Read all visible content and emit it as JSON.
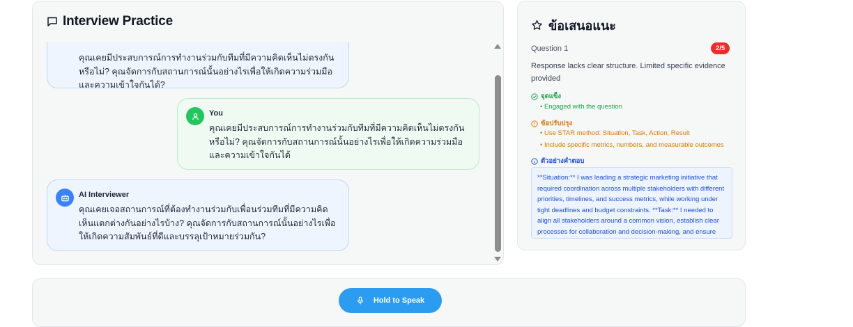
{
  "chat": {
    "title": "Interview Practice",
    "messages": [
      {
        "role": "ai",
        "sender": "",
        "text": "คุณเคยมีประสบการณ์การทำงานร่วมกับทีมที่มีความคิดเห็นไม่ตรงกันหรือไม่? คุณจัดการกับสถานการณ์นั้นอย่างไรเพื่อให้เกิดความร่วมมือและความเข้าใจกันได้?"
      },
      {
        "role": "user",
        "sender": "You",
        "text": "คุณเคยมีประสบการณ์การทำงานร่วมกับทีมที่มีความคิดเห็นไม่ตรงกันหรือไม่? คุณจัดการกับสถานการณ์นั้นอย่างไรเพื่อให้เกิดความร่วมมือและความเข้าใจกันได้"
      },
      {
        "role": "ai",
        "sender": "AI Interviewer",
        "text": "คุณเคยเจอสถานการณ์ที่ต้องทำงานร่วมกับเพื่อนร่วมทีมที่มีความคิดเห็นแตกต่างกันอย่างไรบ้าง? คุณจัดการกับสถานการณ์นั้นอย่างไรเพื่อให้เกิดความสัมพันธ์ที่ดีและบรรลุเป้าหมายร่วมกัน?"
      }
    ]
  },
  "feedback": {
    "title": "ข้อเสนอแนะ",
    "question_label": "Question 1",
    "score": "2/5",
    "summary": "Response lacks clear structure. Limited specific evidence provided",
    "strengths_heading": "จุดแข็ง",
    "strengths": [
      "Engaged with the question"
    ],
    "improvements_heading": "ข้อปรับปรุง",
    "improvements": [
      "Use STAR method: Situation, Task, Action, Result",
      "Include specific metrics, numbers, and measurable outcomes"
    ],
    "example_heading": "ตัวอย่างคำตอบ",
    "example_text": "**Situation:** I was leading a strategic marketing initiative that required coordination across multiple stakeholders with different priorities, timelines, and success metrics, while working under tight deadlines and budget constraints. **Task:** I needed to align all stakeholders around a common vision, establish clear processes for collaboration and decision-making, and ensure"
  },
  "controls": {
    "speak_label": "Hold to Speak"
  },
  "colors": {
    "ai_avatar": "#3b82f6",
    "user_avatar": "#22c55e",
    "score_badge": "#ef2b2b",
    "speak_button": "#2b9cf0",
    "strength": "#16a34a",
    "improvement": "#d97706",
    "example": "#1d4ed8"
  }
}
